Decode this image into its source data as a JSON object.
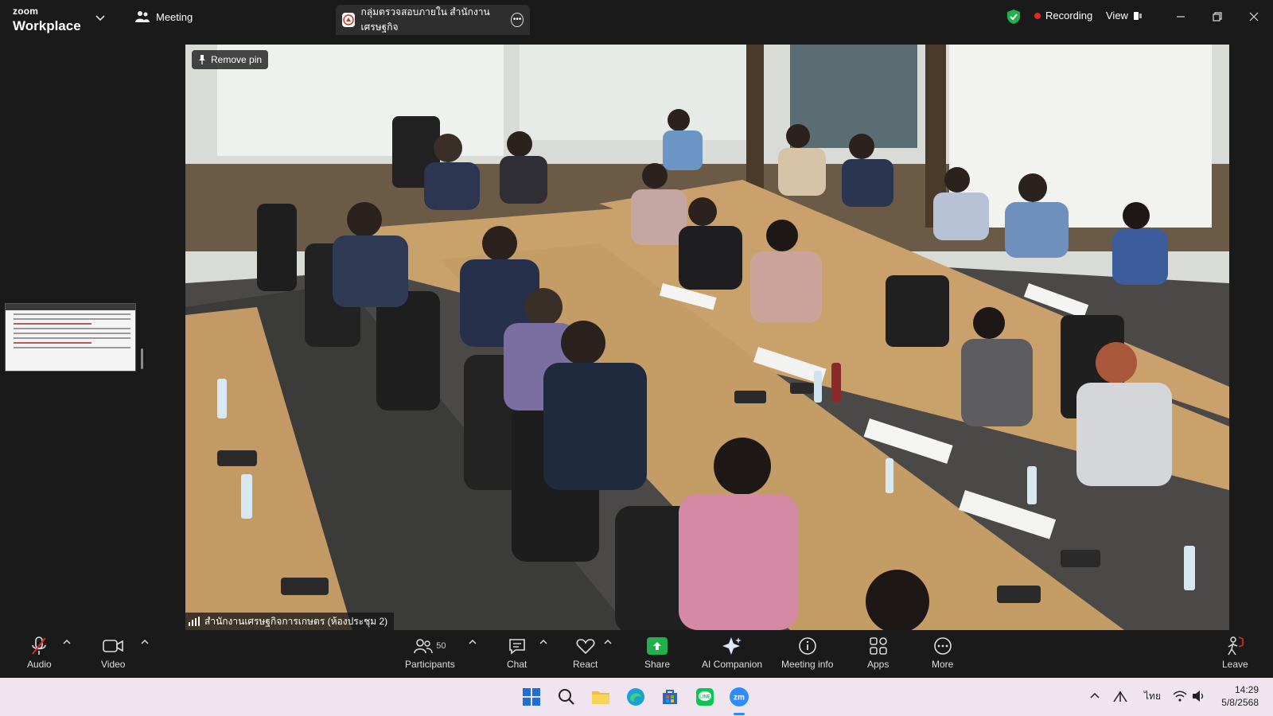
{
  "app": {
    "brand_small": "zoom",
    "brand_big": "Workplace",
    "meeting_menu_label": "Meeting"
  },
  "tab": {
    "title": "กลุ่มตรวจสอบภายใน สำนักงานเศรษฐกิจ"
  },
  "status": {
    "recording_label": "Recording",
    "view_label": "View",
    "recording_color": "#e02828",
    "secure_color": "#21b04b"
  },
  "video": {
    "remove_pin_label": "Remove pin",
    "participant_name": "สำนักงานเศรษฐกิจการเกษตร (ห้องประชุม 2)"
  },
  "toolbar": {
    "audio_label": "Audio",
    "video_label": "Video",
    "participants_label": "Participants",
    "participants_count": "50",
    "chat_label": "Chat",
    "react_label": "React",
    "share_label": "Share",
    "ai_companion_label": "AI Companion",
    "meeting_info_label": "Meeting info",
    "apps_label": "Apps",
    "more_label": "More",
    "leave_label": "Leave"
  },
  "taskbar": {
    "icons": [
      "windows-start-icon",
      "search-icon",
      "file-explorer-icon",
      "edge-icon",
      "store-icon",
      "line-icon",
      "zoom-icon"
    ],
    "language": "ไทย",
    "time": "14:29",
    "date": "5/8/2568"
  }
}
